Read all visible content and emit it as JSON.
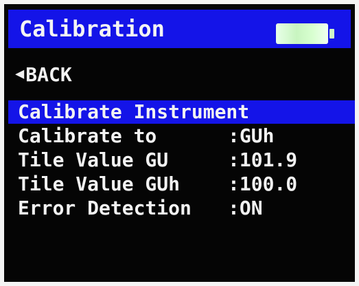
{
  "header": {
    "title": "Calibration",
    "battery_icon": "battery-full-icon",
    "accent_color": "#1414e8"
  },
  "nav": {
    "back_label": "BACK",
    "back_icon": "left-triangle-icon"
  },
  "menu": {
    "items": [
      {
        "label": "Calibrate Instrument",
        "value": "",
        "selected": true
      },
      {
        "label": "Calibrate to",
        "value": ":GUh",
        "selected": false
      },
      {
        "label": "Tile Value GU",
        "value": ":101.9",
        "selected": false
      },
      {
        "label": "Tile Value GUh",
        "value": ":100.0",
        "selected": false
      },
      {
        "label": "Error Detection",
        "value": ":ON",
        "selected": false
      }
    ]
  }
}
